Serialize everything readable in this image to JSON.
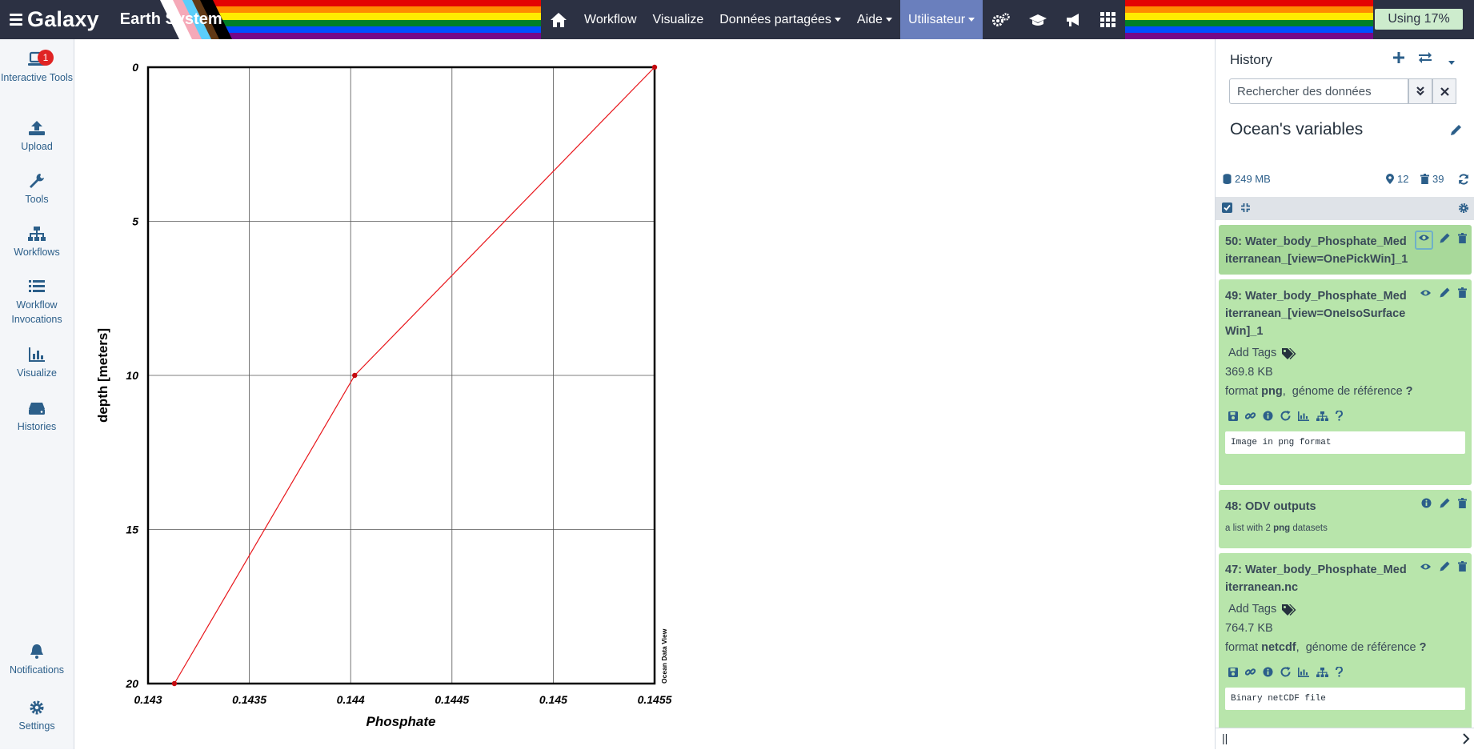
{
  "brand": {
    "logo": "Galaxy",
    "subtitle": "Earth System"
  },
  "nav": {
    "items": [
      "Workflow",
      "Visualize",
      "Données partagées",
      "Aide",
      "Utilisateur"
    ],
    "usage": "Using 17%"
  },
  "activity": {
    "interactive_tools": "Interactive Tools",
    "interactive_badge": "1",
    "upload": "Upload",
    "tools": "Tools",
    "workflows": "Workflows",
    "invocations": "Workflow Invocations",
    "visualize": "Visualize",
    "histories": "Histories",
    "notifications": "Notifications",
    "settings": "Settings"
  },
  "chart_data": {
    "type": "line",
    "x": [
      0.14313,
      0.14402,
      0.1455
    ],
    "y": [
      20,
      10,
      0
    ],
    "xlabel": "Phosphate",
    "ylabel": "depth [meters]",
    "xlim": [
      0.143,
      0.1455
    ],
    "ylim": [
      20,
      0
    ],
    "xticks": [
      "0.143",
      "0.1435",
      "0.144",
      "0.1445",
      "0.145",
      "0.1455"
    ],
    "xtick_values": [
      0.143,
      0.1435,
      0.144,
      0.1445,
      0.145,
      0.1455
    ],
    "yticks": [
      "0",
      "5",
      "10",
      "15",
      "20"
    ],
    "ytick_values": [
      0,
      5,
      10,
      15,
      20
    ],
    "markers": [
      [
        0.14313,
        20
      ],
      [
        0.14402,
        10
      ],
      [
        0.1455,
        0
      ]
    ],
    "watermark": "Ocean Data View",
    "color": "#e8161b",
    "grid": true
  },
  "history": {
    "title": "History",
    "search_placeholder": "Rechercher des données",
    "name": "Ocean's variables",
    "size": "249 MB",
    "shown": "12",
    "deleted": "39",
    "datasets": [
      {
        "title": "50: Water_body_Phosphate_Mediterranean_[view=OnePickWin]_1"
      },
      {
        "title": "49: Water_body_Phosphate_Mediterranean_[view=OneIsoSurfaceWin]_1",
        "tags": "Add Tags",
        "size": "369.8 KB",
        "format_label": "format",
        "format": "png",
        "genome_label": ",  génome de référence",
        "genome": "?",
        "peek": "Image in png format"
      },
      {
        "title": "48: ODV outputs",
        "desc_a": "a list with 2",
        "desc_b": "png",
        "desc_c": "datasets"
      },
      {
        "title": "47: Water_body_Phosphate_Mediterranean.nc",
        "tags": "Add Tags",
        "size": "764.7 KB",
        "format_label": "format",
        "format": "netcdf",
        "genome_label": ",  génome de référence",
        "genome": "?",
        "peek": "Binary netCDF file"
      }
    ],
    "footer": "||"
  },
  "colors": {
    "nav": "#2c3143",
    "accent": "#2c5f8a",
    "dataset_ok": "#b8e5ab",
    "active_nav": "#6a7fbd"
  }
}
